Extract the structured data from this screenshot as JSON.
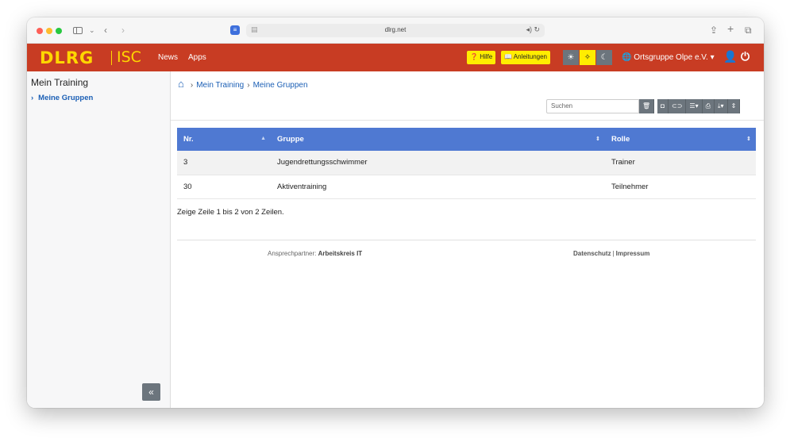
{
  "browser": {
    "url": "dlrg.net",
    "icons": [
      "sidebar-toggle-icon",
      "back-icon",
      "forward-icon",
      "share-icon",
      "new-tab-icon",
      "tabs-icon"
    ]
  },
  "navbar": {
    "logo": "DLRG",
    "logo_sub": "ISC",
    "links": [
      "News",
      "Apps"
    ],
    "help_label": "Hilfe",
    "guides_label": "Anleitungen",
    "org_label": "Ortsgruppe Olpe e.V.",
    "brand_color": "#c83c23",
    "accent_color": "#ffed00"
  },
  "sidebar": {
    "title": "Mein Training",
    "items": [
      {
        "label": "Meine Gruppen"
      }
    ]
  },
  "breadcrumb": [
    "Mein Training",
    "Meine Gruppen"
  ],
  "toolbar": {
    "search_placeholder": "Suchen"
  },
  "table": {
    "columns": [
      "Nr.",
      "Gruppe",
      "Rolle"
    ],
    "rows": [
      [
        "3",
        "Jugendrettungsschwimmer",
        "Trainer"
      ],
      [
        "30",
        "Aktiventraining",
        "Teilnehmer"
      ]
    ],
    "header_color": "#4f79d2"
  },
  "footer": {
    "row_info": "Zeige Zeile 1 bis 2 von 2 Zeilen.",
    "contact_prefix": "Ansprechpartner:",
    "contact_name": "Arbeitskreis IT",
    "privacy": "Datenschutz",
    "imprint": "Impressum"
  }
}
